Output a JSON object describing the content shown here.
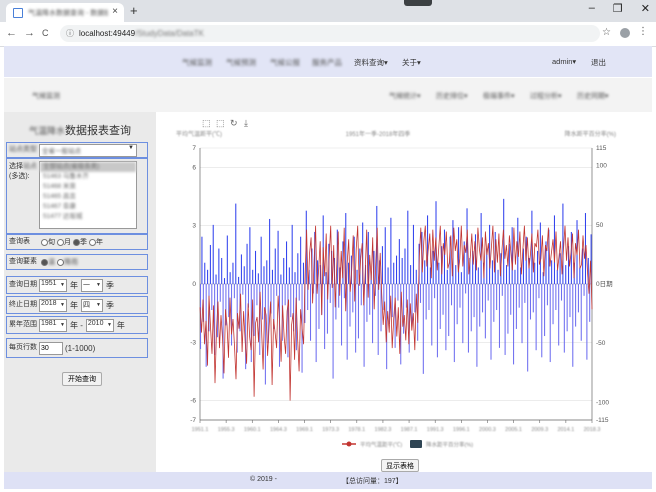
{
  "browser": {
    "tab_title": "气温降水数据查询 - 数据统计",
    "tab_close": "×",
    "new_tab": "+",
    "win_min": "–",
    "win_max": "❐",
    "win_close": "✕",
    "url_host": "localhost:49449",
    "url_path": "/StudyData/DataTK",
    "back": "←",
    "forward": "→",
    "reload": "C",
    "star": "☆",
    "menu": "⋮",
    "info": "ⓘ"
  },
  "topnav": {
    "items": [
      "气候监测",
      "气候预测",
      "气候公报",
      "服务产品",
      "资料查询▾",
      "关于▾"
    ],
    "user": "admin▾",
    "logout": "退出"
  },
  "subnav": {
    "left": "气候监测",
    "items": [
      "气候统计▾",
      "历史排位▾",
      "极端事件▾",
      "过程分析▾",
      "历史同期▾"
    ]
  },
  "form": {
    "title_blur": "气温降水",
    "title": "数据报表查询",
    "station_type_label": "站点类型",
    "station_type_value": "全省一般站点",
    "station_label_a": "选择",
    "station_label_b": "站点",
    "station_label_c": "(多选):",
    "stations": [
      "全部站点(省级各类)",
      "51463 乌鲁木齐",
      "51468 米泉",
      "51465 昌吉",
      "51467 阜康",
      "51477 达坂城"
    ],
    "table_label": "查询表",
    "table_options": [
      "旬",
      "月",
      "季",
      "年"
    ],
    "elements_label": "查询要素",
    "element_options": [
      "温",
      "降雨"
    ],
    "query_date_label": "查询日期",
    "start_year": "1951",
    "year_unit": "年",
    "start_season": "一",
    "season_unit": "季",
    "end_date_label": "终止日期",
    "end_year": "2018",
    "end_season": "四",
    "climate_label": "累年范围",
    "climate_start": "1981",
    "range_sep": "年 -",
    "climate_end": "2010",
    "rows_label": "每页行数",
    "rows_value": "30",
    "rows_hint": "(1-1000)",
    "start_button": "开始查询"
  },
  "chart_data": {
    "type": "bar+line",
    "toolbox": [
      "⬚",
      "⬚",
      "↻",
      "⤓"
    ],
    "title": "1951年一季-2018年四季",
    "ylabel_left": "平均气温距平(℃)",
    "ylabel_right": "降水距平百分率(%)",
    "y_left": {
      "min": -7,
      "max": 7,
      "ticks": [
        7,
        6,
        3,
        0,
        -3,
        -6,
        -7
      ]
    },
    "y_right": {
      "min": -115,
      "max": 115,
      "ticks": [
        115,
        100,
        50,
        0,
        -50,
        -100,
        -115
      ]
    },
    "right_zero_label": "0日期",
    "x_ticks": [
      "1951.1",
      "1955.3",
      "1960.1",
      "1964.3",
      "1969.1",
      "1973.3",
      "1978.1",
      "1982.3",
      "1987.1",
      "1991.3",
      "1996.1",
      "2000.3",
      "2005.1",
      "2009.3",
      "2014.1",
      "2018.3"
    ],
    "legend": [
      {
        "name": "平均气温距平(℃)",
        "color": "#c23531",
        "symbol": "line"
      },
      {
        "name": "降水距平百分率(%)",
        "color": "#2f4554",
        "symbol": "rect"
      }
    ],
    "bar_color": "#3344ee",
    "line_color": "#c23531",
    "n_points": 272,
    "precip_anomaly_percent": [
      -55,
      40,
      -32,
      18,
      -70,
      12,
      -40,
      33,
      -22,
      50,
      -60,
      8,
      -45,
      30,
      -15,
      22,
      -80,
      5,
      -35,
      41,
      -28,
      10,
      -52,
      18,
      -12,
      68,
      -58,
      6,
      -40,
      25,
      -9,
      15,
      -72,
      34,
      -20,
      48,
      -66,
      12,
      -44,
      28,
      -18,
      9,
      -60,
      40,
      -30,
      15,
      -85,
      20,
      -50,
      55,
      -25,
      12,
      -38,
      30,
      -10,
      45,
      -70,
      8,
      -48,
      22,
      -18,
      36,
      -62,
      14,
      -28,
      50,
      -40,
      10,
      -56,
      26,
      -14,
      40,
      -75,
      18,
      -33,
      62,
      -22,
      12,
      -48,
      30,
      -8,
      44,
      -66,
      20,
      -38,
      16,
      -26,
      58,
      -55,
      10,
      -42,
      34,
      -16,
      28,
      -80,
      22,
      -30,
      46,
      -20,
      14,
      -52,
      36,
      -12,
      60,
      -64,
      18,
      -36,
      24,
      -24,
      40,
      -58,
      12,
      -46,
      30,
      -18,
      52,
      -70,
      16,
      -32,
      44,
      -26,
      10,
      -50,
      28,
      -10,
      66,
      -60,
      20,
      -40,
      32,
      -22,
      48,
      -72,
      14,
      -34,
      56,
      -28,
      18,
      -54,
      24,
      -14,
      38,
      -68,
      22,
      -42,
      30,
      -20,
      62,
      -58,
      16,
      -36,
      50,
      -24,
      12,
      -48,
      34,
      -16,
      44,
      -76,
      20,
      -30,
      58,
      -22,
      14,
      -52,
      28,
      -12,
      70,
      -62,
      18,
      -38,
      32,
      -26,
      46,
      -56,
      12,
      -44,
      40,
      -18,
      54,
      -66,
      16,
      -34,
      48,
      -20,
      10,
      -50,
      36,
      -8,
      64,
      -58,
      22,
      -40,
      28,
      -28,
      42,
      -70,
      14,
      -36,
      60,
      -24,
      18,
      -46,
      30,
      -14,
      50,
      -64,
      20,
      -32,
      44,
      -22,
      12,
      -54,
      26,
      -10,
      72,
      -60,
      16,
      -42,
      34,
      -26,
      48,
      -68,
      12,
      -38,
      56,
      -20,
      14,
      -50,
      30,
      -16,
      40,
      -74,
      22,
      -30,
      62,
      -24,
      18,
      -56,
      28,
      -12,
      52,
      -62,
      10,
      -44,
      36,
      -18,
      46,
      -66,
      20,
      -34,
      58,
      -22,
      12,
      -52,
      26,
      -14,
      68,
      -58,
      16,
      -40,
      32,
      -28,
      44,
      -70,
      18,
      -36,
      54,
      -24,
      14,
      -48,
      30,
      -10,
      60,
      -64,
      22,
      -32,
      42
    ],
    "temp_anomaly_c": [
      -1.2,
      -2.5,
      -0.8,
      -3.1,
      -1.9,
      -4.2,
      -0.6,
      -2.2,
      -3.6,
      -1.1,
      -5.1,
      -2.4,
      -0.9,
      -3.3,
      -1.6,
      -2.8,
      -4.6,
      -1.3,
      -2.1,
      -3.8,
      -0.7,
      -2.6,
      -1.8,
      -3.2,
      -4.9,
      -1.5,
      -2.3,
      -0.5,
      -3.5,
      -1.4,
      -2.9,
      -4.1,
      -1.0,
      -2.7,
      -3.4,
      -0.8,
      -5.8,
      -2.0,
      -1.7,
      -3.0,
      -0.4,
      -2.4,
      -4.4,
      -1.2,
      -1.6,
      -3.7,
      -2.2,
      -0.9,
      -5.2,
      -1.8,
      -2.5,
      -3.3,
      -0.6,
      -2.0,
      -4.0,
      -1.1,
      -2.7,
      -3.6,
      -1.4,
      -0.8,
      -6.0,
      -2.1,
      -1.5,
      -3.9,
      -0.7,
      -2.8,
      -4.5,
      -1.3,
      -2.3,
      -3.1,
      0.5,
      2.8,
      -0.3,
      1.6,
      2.4,
      -1.0,
      1.2,
      3.0,
      -0.5,
      0.8,
      2.2,
      -1.6,
      1.9,
      0.4,
      2.6,
      -0.8,
      1.4,
      3.0,
      -0.2,
      2.0,
      -1.2,
      0.9,
      2.7,
      -0.6,
      1.7,
      0.3,
      2.9,
      -1.4,
      1.1,
      2.3,
      -0.4,
      0.7,
      2.5,
      -0.9,
      1.8,
      3.0,
      -0.1,
      1.3,
      2.1,
      -1.1,
      0.6,
      2.8,
      -0.7,
      1.5,
      0.2,
      2.4,
      -1.3,
      1.0,
      2.9,
      -0.3,
      1.6,
      -0.5,
      -2.1,
      -0.9,
      -3.0,
      -1.4,
      -2.5,
      -0.6,
      -3.3,
      -1.8,
      -0.7,
      -2.7,
      -1.2,
      -3.6,
      -0.4,
      -2.2,
      -1.6,
      -2.9,
      -0.8,
      -3.1,
      -1.0,
      -2.4,
      -1.5,
      -3.4,
      -0.5,
      -2.0,
      1.4,
      2.9,
      0.6,
      2.2,
      3.0,
      0.9,
      1.8,
      2.6,
      0.3,
      2.8,
      1.2,
      2.4,
      0.7,
      1.9,
      3.0,
      0.5,
      2.1,
      1.5,
      2.7,
      0.8,
      1.1,
      2.5,
      0.4,
      2.9,
      1.7,
      2.3,
      0.6,
      1.3,
      3.0,
      0.9,
      2.0,
      1.6,
      2.8,
      0.5,
      1.4,
      2.6,
      1.0,
      2.2,
      0.7,
      2.9,
      1.8,
      1.2,
      2.4,
      0.3,
      2.7,
      1.5,
      2.1,
      0.8,
      1.9,
      3.0,
      0.6,
      2.3,
      1.1,
      2.6,
      0.4,
      1.7,
      2.8,
      1.3,
      2.0,
      0.9,
      2.5,
      1.6,
      0.7,
      2.9,
      1.0,
      2.2,
      1.4,
      2.7,
      0.5,
      1.8,
      3.0,
      1.2,
      2.4,
      0.8,
      1.5,
      2.6,
      0.6,
      2.1,
      1.9,
      2.8,
      1.0,
      1.3,
      2.5,
      0.4,
      2.0,
      1.7,
      2.9,
      0.9,
      1.6,
      2.3,
      1.1,
      2.7,
      0.7,
      1.4,
      2.2,
      0.5,
      1.8,
      3.0,
      1.2,
      2.4,
      0.9,
      1.6,
      2.6,
      0.3,
      2.1,
      1.5,
      2.8,
      0.8,
      1.0,
      2.5,
      1.3,
      2.0,
      0.6,
      -0.5,
      1.2,
      -1.3
    ]
  },
  "table_button": "显示表格",
  "footer": {
    "copyright": "© 2019 -",
    "visits": "【总访问量：197】"
  }
}
